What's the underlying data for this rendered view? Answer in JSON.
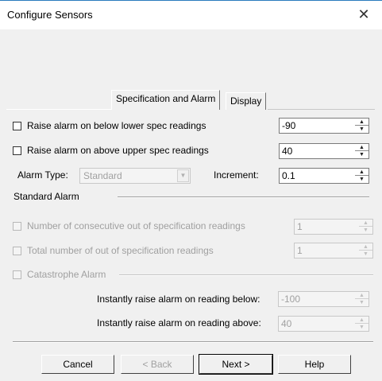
{
  "window": {
    "title": "Configure Sensors",
    "close_icon": "close-icon"
  },
  "tabs": [
    {
      "label": "Specification and Alarm",
      "active": true
    },
    {
      "label": "Display",
      "active": false
    }
  ],
  "spec": {
    "lower": {
      "label": "Raise alarm on below lower spec readings",
      "checked": false,
      "value": "-90"
    },
    "upper": {
      "label": "Raise alarm on above upper spec readings",
      "checked": false,
      "value": "40"
    },
    "alarm_type_label": "Alarm Type:",
    "alarm_type_value": "Standard",
    "increment_label": "Increment:",
    "increment_value": "0.1"
  },
  "standard_alarm": {
    "heading": "Standard Alarm",
    "consecutive": {
      "label": "Number of consecutive out of specification readings",
      "value": "1"
    },
    "total": {
      "label": "Total number of out of specification readings",
      "value": "1"
    }
  },
  "catastrophe": {
    "label": "Catastrophe Alarm",
    "below_label": "Instantly raise alarm on reading below:",
    "below_value": "-100",
    "above_label": "Instantly raise alarm on reading above:",
    "above_value": "40"
  },
  "buttons": {
    "cancel": "Cancel",
    "back": "< Back",
    "next": "Next >",
    "help": "Help"
  },
  "colors": {
    "title_border": "#2b7bbd",
    "dialog_bg": "#f0f0f0",
    "disabled_text": "#a0a0a0"
  }
}
